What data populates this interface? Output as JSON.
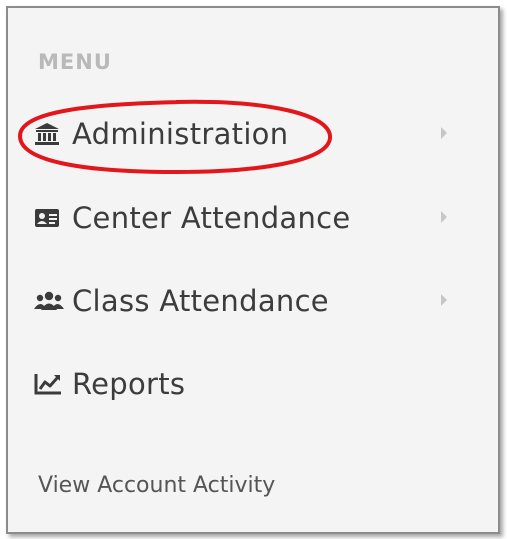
{
  "menu": {
    "heading": "MENU",
    "items": [
      {
        "label": "Administration",
        "icon": "bank-icon",
        "has_submenu": true
      },
      {
        "label": "Center Attendance",
        "icon": "id-card-icon",
        "has_submenu": true
      },
      {
        "label": "Class Attendance",
        "icon": "users-icon",
        "has_submenu": true
      },
      {
        "label": "Reports",
        "icon": "line-chart-icon",
        "has_submenu": false
      }
    ]
  },
  "footer": {
    "link_label": "View Account Activity"
  },
  "colors": {
    "panel_bg": "#f4f4f4",
    "text": "#3c3c3c",
    "heading": "#b9b9b9",
    "highlight": "#e3161b"
  }
}
